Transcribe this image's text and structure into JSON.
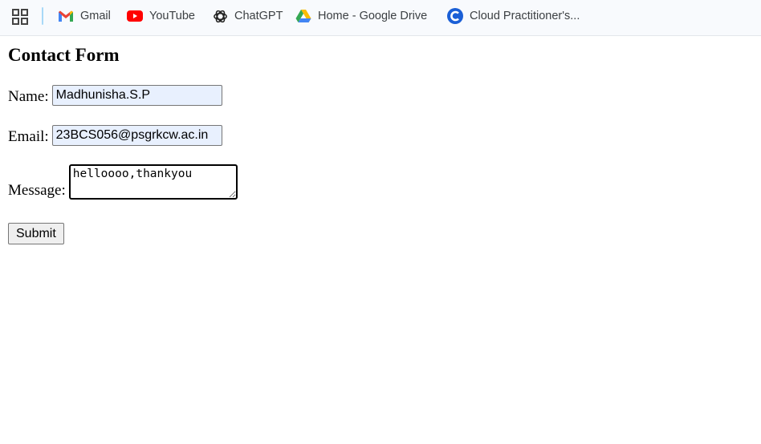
{
  "bookmarks_bar": {
    "items": [
      {
        "label": "Gmail",
        "icon": "gmail-icon"
      },
      {
        "label": "YouTube",
        "icon": "youtube-icon"
      },
      {
        "label": "ChatGPT",
        "icon": "chatgpt-icon"
      },
      {
        "label": "Home - Google Drive",
        "icon": "google-drive-icon"
      },
      {
        "label": "Cloud Practitioner's...",
        "icon": "cloud-practitioner-icon"
      }
    ]
  },
  "form": {
    "title": "Contact Form",
    "name_label": "Name:",
    "name_value": "Madhunisha.S.P",
    "email_label": "Email:",
    "email_value": "23BCS056@psgrkcw.ac.in",
    "message_label": "Message:",
    "message_value": "helloooo,thankyou",
    "submit_label": "Submit"
  },
  "colors": {
    "autofill_bg": "#e8f0fe",
    "bookmarks_bg": "#f8fafd",
    "separator": "#a8d8f8"
  }
}
